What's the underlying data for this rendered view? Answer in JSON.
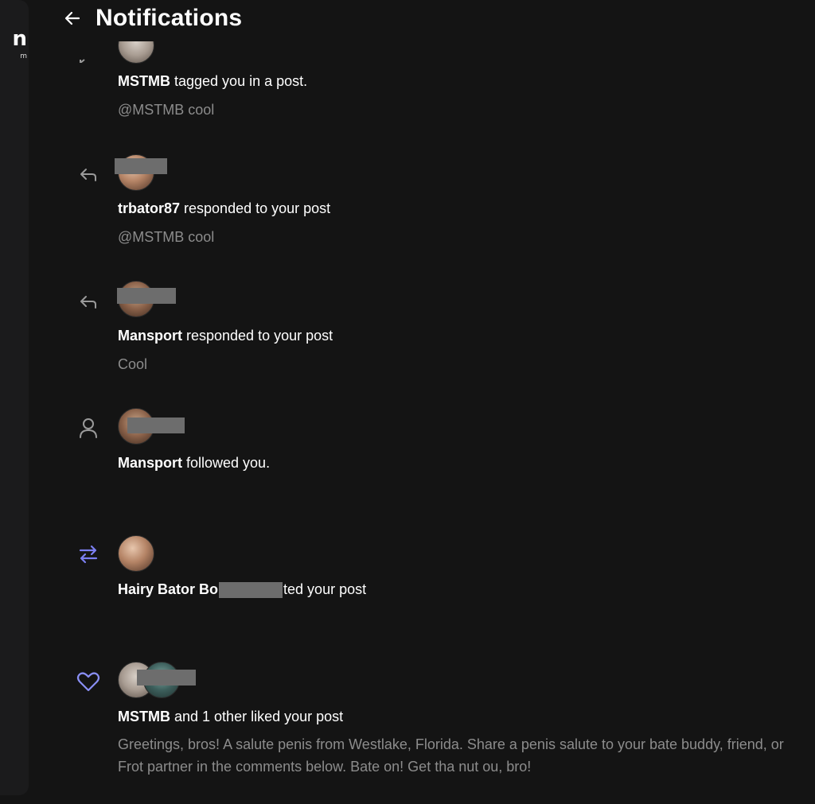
{
  "sidebar": {
    "brand_fragment": "n",
    "brand_sub": "m"
  },
  "header": {
    "title": "Notifications"
  },
  "notifications": [
    {
      "type_icon": "speech-bubble-icon",
      "username": "MSTMB",
      "action": " tagged you in a post.",
      "content": "@MSTMB cool"
    },
    {
      "type_icon": "reply-icon",
      "username": "trbator87",
      "action": " responded to your post",
      "content": "@MSTMB cool"
    },
    {
      "type_icon": "reply-icon",
      "username": "Mansport",
      "action": " responded to your post",
      "content": "Cool"
    },
    {
      "type_icon": "user-icon",
      "username": "Mansport",
      "action": " followed you.",
      "content": ""
    },
    {
      "type_icon": "repost-icon",
      "username": "Hairy Bator Bo",
      "action": "ted your post",
      "content": ""
    },
    {
      "type_icon": "heart-icon",
      "username": "MSTMB",
      "action": " and 1 other liked your post",
      "content": "Greetings, bros! A salute penis from Westlake, Florida. Share a penis salute to your bate buddy, friend, or Frot partner in the comments below. Bate on! Get tha nut ou, bro!"
    }
  ],
  "colors": {
    "accent": "#7b7ff0",
    "background": "#141414",
    "muted_text": "#8c8c8c"
  }
}
